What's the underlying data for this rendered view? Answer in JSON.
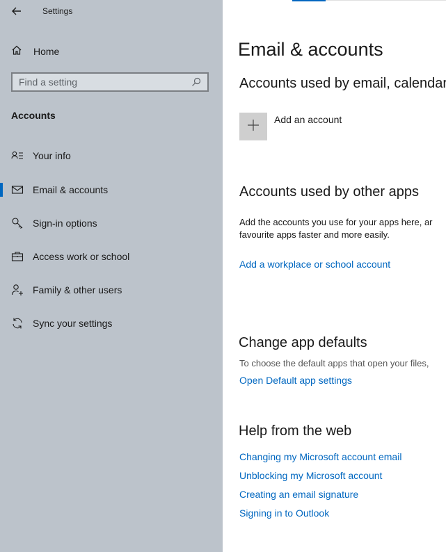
{
  "window": {
    "title": "Settings"
  },
  "sidebar": {
    "home_label": "Home",
    "search_placeholder": "Find a setting",
    "section_title": "Accounts",
    "items": [
      {
        "label": "Your info",
        "icon": "person-card-icon",
        "selected": false
      },
      {
        "label": "Email & accounts",
        "icon": "mail-icon",
        "selected": true
      },
      {
        "label": "Sign-in options",
        "icon": "key-icon",
        "selected": false
      },
      {
        "label": "Access work or school",
        "icon": "briefcase-icon",
        "selected": false
      },
      {
        "label": "Family & other users",
        "icon": "person-add-icon",
        "selected": false
      },
      {
        "label": "Sync your settings",
        "icon": "sync-icon",
        "selected": false
      }
    ]
  },
  "main": {
    "page_title": "Email & accounts",
    "email_section": {
      "heading": "Accounts used by email, calendar",
      "add_account_label": "Add an account"
    },
    "other_apps_section": {
      "heading": "Accounts used by other apps",
      "description_line1": "Add the accounts you use for your apps here, ar",
      "description_line2": "favourite apps faster and more easily.",
      "link": "Add a workplace or school account"
    },
    "defaults_section": {
      "heading": "Change app defaults",
      "description": "To choose the default apps that open your files,",
      "link": "Open Default app settings"
    },
    "help_section": {
      "heading": "Help from the web",
      "links": [
        "Changing my Microsoft account email",
        "Unblocking my Microsoft account",
        "Creating an email signature",
        "Signing in to Outlook"
      ]
    }
  },
  "colors": {
    "accent": "#0067c0",
    "sidebar_bg": "#bcc3cb"
  }
}
